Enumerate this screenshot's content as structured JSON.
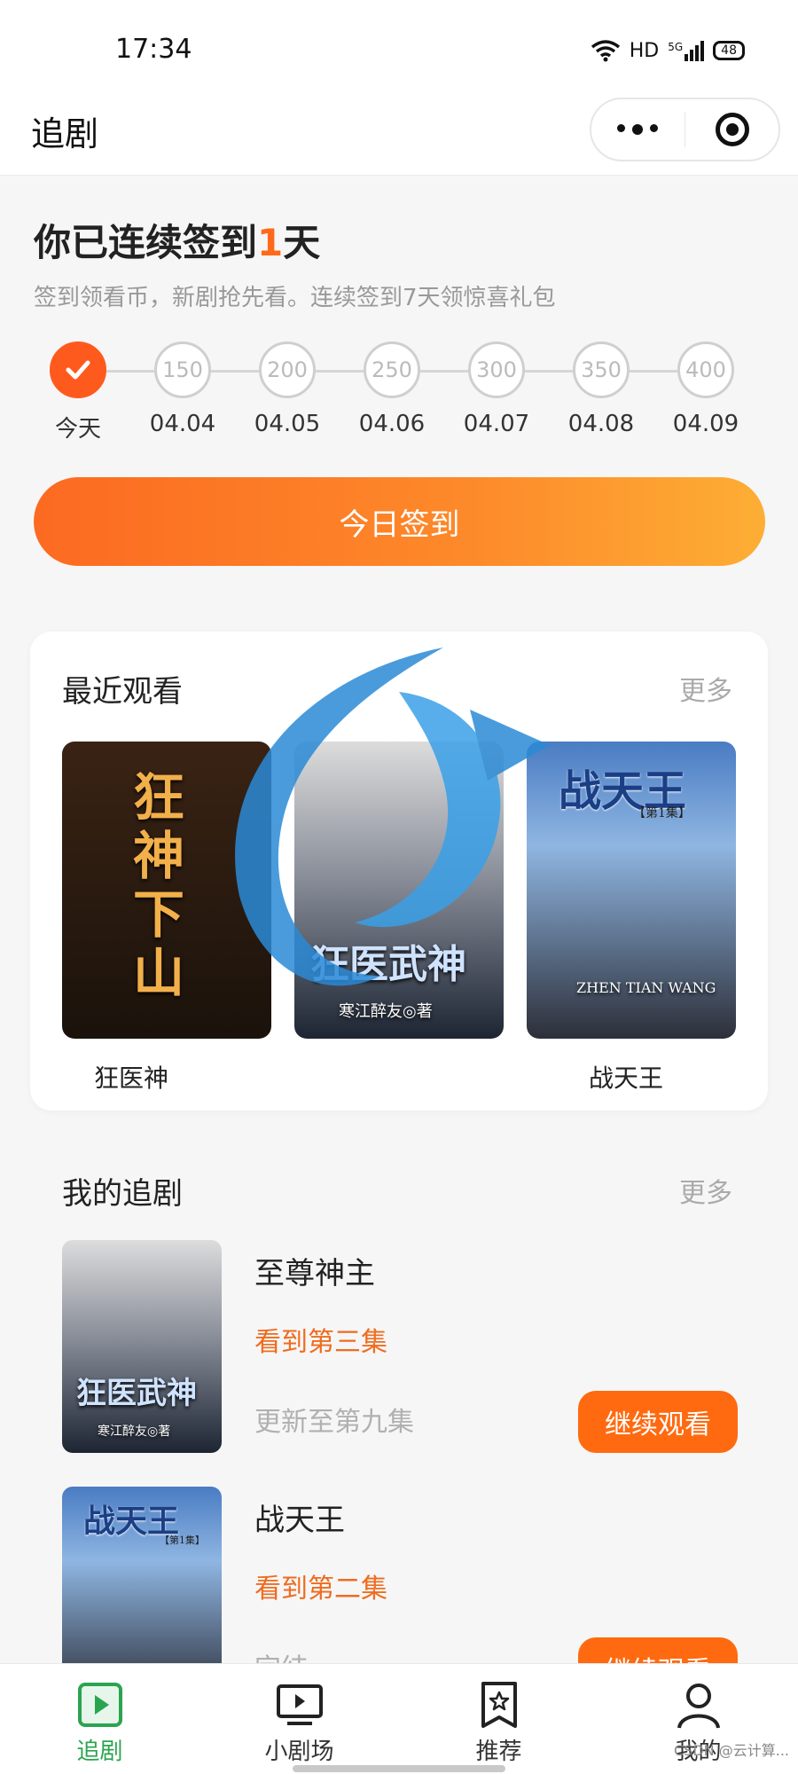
{
  "status_bar": {
    "time": "17:34",
    "network": "HD",
    "signal": "5G",
    "battery": "48"
  },
  "nav": {
    "title": "追剧"
  },
  "signin": {
    "title_prefix": "你已连续签到",
    "days": "1",
    "title_suffix": "天",
    "subtitle": "签到领看币，新剧抢先看。连续签到7天领惊喜礼包",
    "steps": [
      {
        "value": "",
        "date": "今天",
        "done": true
      },
      {
        "value": "150",
        "date": "04.04"
      },
      {
        "value": "200",
        "date": "04.05"
      },
      {
        "value": "250",
        "date": "04.06"
      },
      {
        "value": "300",
        "date": "04.07"
      },
      {
        "value": "350",
        "date": "04.08"
      },
      {
        "value": "400",
        "date": "04.09"
      }
    ],
    "button_label": "今日签到"
  },
  "recent": {
    "title": "最近观看",
    "more": "更多",
    "items": [
      {
        "name": "狂医神",
        "poster_text": "狂神下山"
      },
      {
        "name": "",
        "poster_text": "狂医武神",
        "poster_author": "寒江醉友◎著"
      },
      {
        "name": "战天王",
        "poster_text": "战天王",
        "poster_sub": "ZHEN TIAN WANG",
        "poster_badge": "【第1集】"
      }
    ]
  },
  "my_shows": {
    "title": "我的追剧",
    "more": "更多",
    "items": [
      {
        "name": "至尊神主",
        "progress": "看到第三集",
        "update": "更新至第九集",
        "button": "继续观看",
        "poster_text": "狂医武神",
        "poster_author": "寒江醉友◎著"
      },
      {
        "name": "战天王",
        "progress": "看到第二集",
        "update": "完结",
        "button": "继续观看",
        "poster_text": "战天王",
        "poster_badge": "【第1集】"
      }
    ]
  },
  "tabs": [
    {
      "label": "追剧",
      "icon": "play-square-icon",
      "active": true
    },
    {
      "label": "小剧场",
      "icon": "tv-play-icon"
    },
    {
      "label": "推荐",
      "icon": "star-bookmark-icon"
    },
    {
      "label": "我的",
      "icon": "user-icon"
    }
  ],
  "watermark": "CSDN @云计算..."
}
